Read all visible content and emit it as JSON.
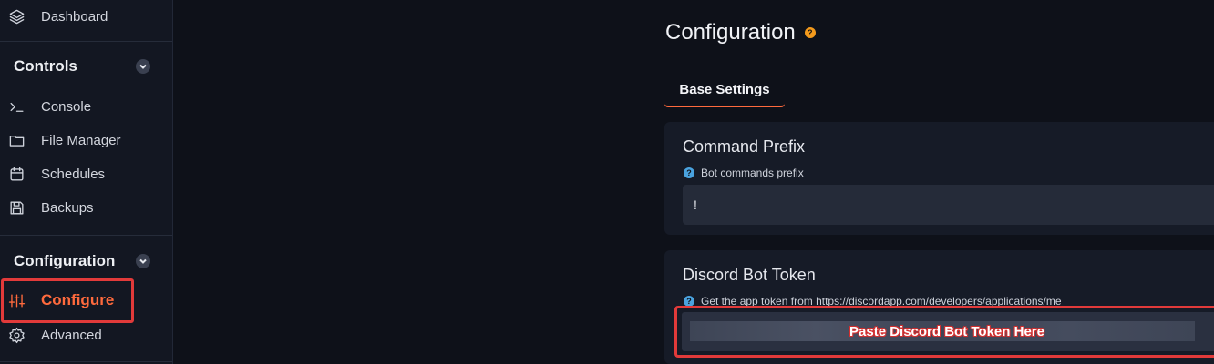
{
  "sidebar": {
    "dashboard": {
      "label": "Dashboard",
      "icon": "layers-icon"
    },
    "controls_header": "Controls",
    "controls": [
      {
        "label": "Console",
        "icon": "terminal-icon"
      },
      {
        "label": "File Manager",
        "icon": "folder-icon"
      },
      {
        "label": "Schedules",
        "icon": "calendar-icon"
      },
      {
        "label": "Backups",
        "icon": "save-icon"
      }
    ],
    "configuration_header": "Configuration",
    "configuration": [
      {
        "label": "Configure",
        "icon": "sliders-icon",
        "active": true
      },
      {
        "label": "Advanced",
        "icon": "gear-icon"
      }
    ]
  },
  "main": {
    "title": "Configuration",
    "help_glyph": "?",
    "tabs": [
      {
        "label": "Base Settings",
        "active": true
      }
    ],
    "fields": {
      "prefix": {
        "title": "Command Prefix",
        "hint": "Bot commands prefix",
        "value": "!"
      },
      "token": {
        "title": "Discord Bot Token",
        "hint": "Get the app token from https://discordapp.com/developers/applications/me",
        "annotation": "Paste Discord Bot Token Here"
      }
    }
  },
  "colors": {
    "accent": "#ff6a3d",
    "highlight": "#e23a3a",
    "help_orange": "#f39a1c",
    "help_blue": "#4aa3df"
  }
}
